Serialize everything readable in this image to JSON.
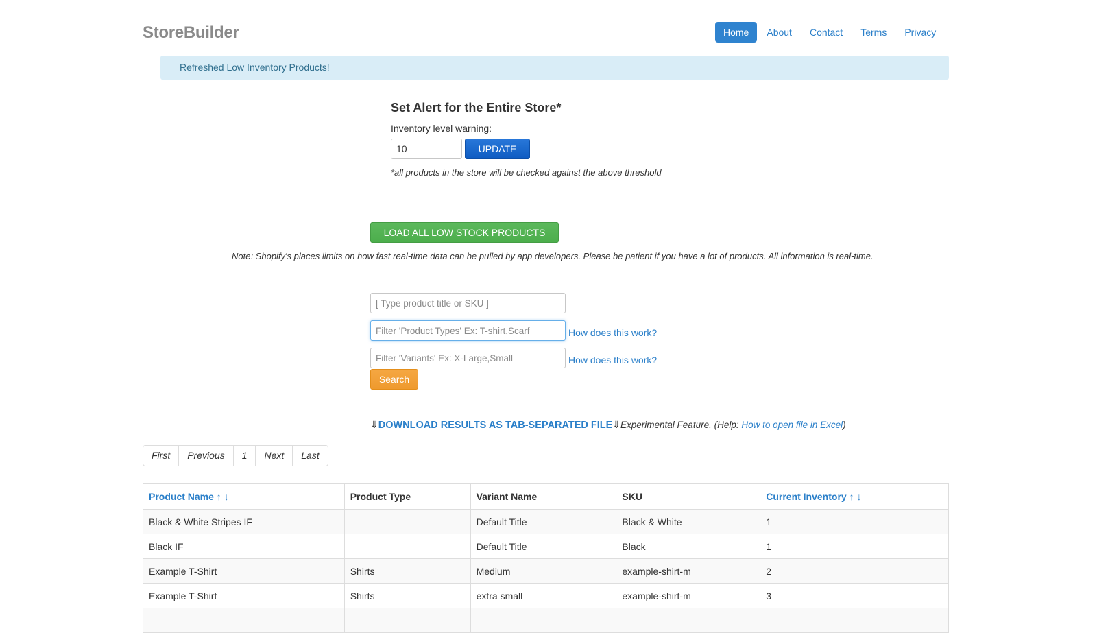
{
  "brand": "StoreBuilder",
  "nav": {
    "items": [
      {
        "label": "Home",
        "active": true
      },
      {
        "label": "About"
      },
      {
        "label": "Contact"
      },
      {
        "label": "Terms"
      },
      {
        "label": "Privacy"
      }
    ]
  },
  "alert": {
    "message": "Refreshed Low Inventory Products!"
  },
  "store_alert": {
    "title": "Set Alert for the Entire Store*",
    "label": "Inventory level warning:",
    "value": "10",
    "update_label": "UPDATE",
    "note": "*all products in the store will be checked against the above threshold"
  },
  "load": {
    "button_label": "LOAD ALL LOW STOCK PRODUCTS",
    "note": "Note: Shopify's places limits on how fast real-time data can be pulled by app developers. Please be patient if you have a lot of products. All information is real-time."
  },
  "filters": {
    "title_placeholder": "[ Type product title or SKU ]",
    "types_placeholder": "Filter 'Product Types' Ex: T-shirt,Scarf",
    "variants_placeholder": "Filter 'Variants' Ex: X-Large,Small",
    "how_label": "How does this work?",
    "search_label": "Search"
  },
  "download": {
    "arrow": "⇓",
    "link_label": "DOWNLOAD RESULTS AS TAB-SEPARATED FILE",
    "experimental": "Experimental Feature. (Help: ",
    "help_link": "How to open file in Excel",
    "close": ")"
  },
  "pagination": {
    "first": "First",
    "previous": "Previous",
    "page": "1",
    "next": "Next",
    "last": "Last"
  },
  "table": {
    "headers": {
      "product_name": "Product Name ↑ ↓",
      "product_type": "Product Type",
      "variant_name": "Variant Name",
      "sku": "SKU",
      "current_inventory": "Current Inventory ↑ ↓"
    },
    "rows": [
      {
        "product_name": "Black & White Stripes IF",
        "product_type": "",
        "variant_name": "Default Title",
        "sku": "Black & White",
        "inventory": "1"
      },
      {
        "product_name": "Black IF",
        "product_type": "",
        "variant_name": "Default Title",
        "sku": "Black",
        "inventory": "1"
      },
      {
        "product_name": "Example T-Shirt",
        "product_type": "Shirts",
        "variant_name": "Medium",
        "sku": "example-shirt-m",
        "inventory": "2"
      },
      {
        "product_name": "Example T-Shirt",
        "product_type": "Shirts",
        "variant_name": "extra small",
        "sku": "example-shirt-m",
        "inventory": "3"
      },
      {
        "product_name": "",
        "product_type": "",
        "variant_name": "",
        "sku": "",
        "inventory": ""
      }
    ]
  }
}
